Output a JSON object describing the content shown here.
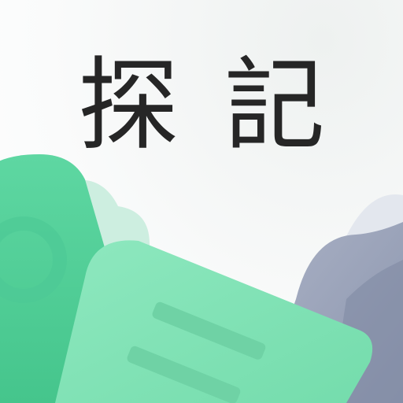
{
  "logo": {
    "char_1": "探",
    "char_2": "記"
  },
  "colors": {
    "ink": "#262626",
    "green_dark": "#54d19a",
    "green_light": "#82e4b7",
    "mint_ghost": "#b9ebd6",
    "slate": "#9aa3b9",
    "slate_light": "#d3d8e3"
  }
}
